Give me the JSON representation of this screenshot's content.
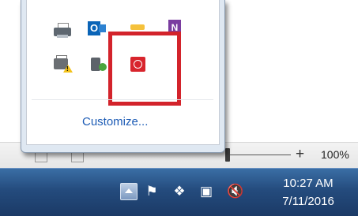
{
  "popup": {
    "customize_label": "Customize..."
  },
  "statusbar": {
    "zoom_plus": "+",
    "zoom_percent": "100%"
  },
  "taskbar": {
    "time": "10:27 AM",
    "date": "7/11/2016"
  },
  "icons": {
    "tray_row1": [
      "printer-icon",
      "outlook-icon",
      "notification-icon",
      "onenote-icon"
    ],
    "tray_row2": [
      "printer-warning-icon",
      "power-plug-icon",
      "red-app-icon"
    ],
    "taskbar_tray": [
      "show-hidden-icons-button",
      "action-center-flag-icon",
      "dropbox-icon",
      "network-icon",
      "volume-muted-icon"
    ]
  },
  "colors": {
    "highlight": "#d3232b",
    "taskbar": "#244b7d",
    "link": "#1c5bb5"
  },
  "text": {
    "outlook_letter": "O",
    "onenote_letter": "N"
  }
}
